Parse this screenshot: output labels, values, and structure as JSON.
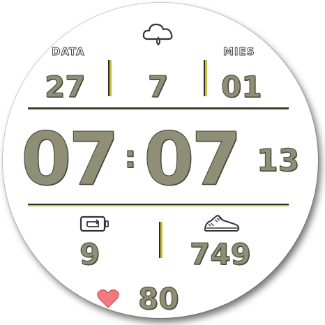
{
  "date": {
    "label_left": "DATA",
    "label_right": "MIES",
    "day": "27",
    "weekday": "7",
    "month": "01"
  },
  "time": {
    "hours": "07",
    "separator": ":",
    "minutes": "07",
    "seconds": "13"
  },
  "stats": {
    "battery": "9",
    "steps": "749",
    "heart_rate": "80"
  },
  "colors": {
    "digit_fill": "#8f8f78",
    "accent_line": "#c9c33a",
    "heart": "#f27a7f"
  },
  "icons": {
    "weather": "cloud-rain-icon",
    "battery": "battery-icon",
    "steps": "shoe-icon",
    "heart": "heart-icon"
  }
}
